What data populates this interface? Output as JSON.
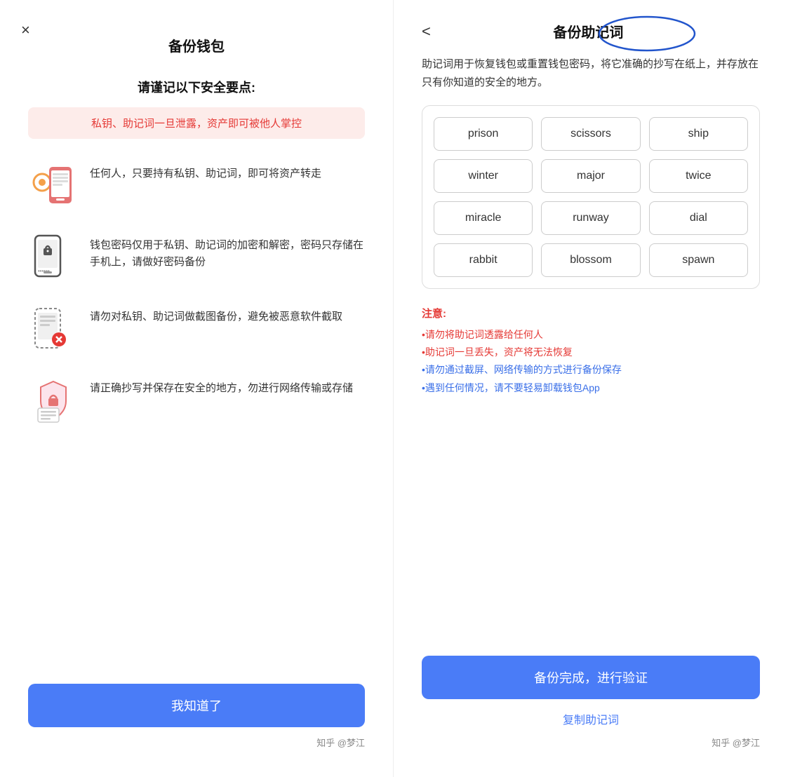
{
  "left": {
    "close_label": "×",
    "title": "备份钱包",
    "section_heading": "请谨记以下安全要点:",
    "warning_text": "私钥、助记词一旦泄露，资产即可被他人掌控",
    "items": [
      {
        "text": "任何人，只要持有私钥、助记词，即可将资产转走",
        "icon_name": "key-phone-icon"
      },
      {
        "text": "钱包密码仅用于私钥、助记词的加密和解密，密码只存储在手机上，请做好密码备份",
        "icon_name": "phone-lock-icon"
      },
      {
        "text": "请勿对私钥、助记词做截图备份，避免被恶意软件截取",
        "icon_name": "screenshot-block-icon"
      },
      {
        "text": "请正确抄写并保存在安全的地方，勿进行网络传输或存储",
        "icon_name": "save-doc-icon"
      }
    ],
    "confirm_button": "我知道了",
    "watermark": "知乎 @梦江"
  },
  "right": {
    "back_label": "<",
    "title": "备份助记词",
    "description": "助记词用于恢复钱包或重置钱包密码，将它准确的抄写在纸上，并存放在只有你知道的安全的地方。",
    "mnemonic_words": [
      "prison",
      "scissors",
      "ship",
      "winter",
      "major",
      "twice",
      "miracle",
      "runway",
      "dial",
      "rabbit",
      "blossom",
      "spawn"
    ],
    "notice_title": "注意:",
    "notices": [
      {
        "text": "•请勿将助记词透露给任何人",
        "color": "red"
      },
      {
        "text": "•助记词一旦丢失，资产将无法恢复",
        "color": "red"
      },
      {
        "text": "•请勿通过截屏、网络传输的方式进行备份保存",
        "color": "blue"
      },
      {
        "text": "•遇到任何情况，请不要轻易卸载钱包App",
        "color": "blue"
      }
    ],
    "verify_button": "备份完成，进行验证",
    "copy_link": "复制助记词",
    "watermark": "知乎 @梦江"
  }
}
